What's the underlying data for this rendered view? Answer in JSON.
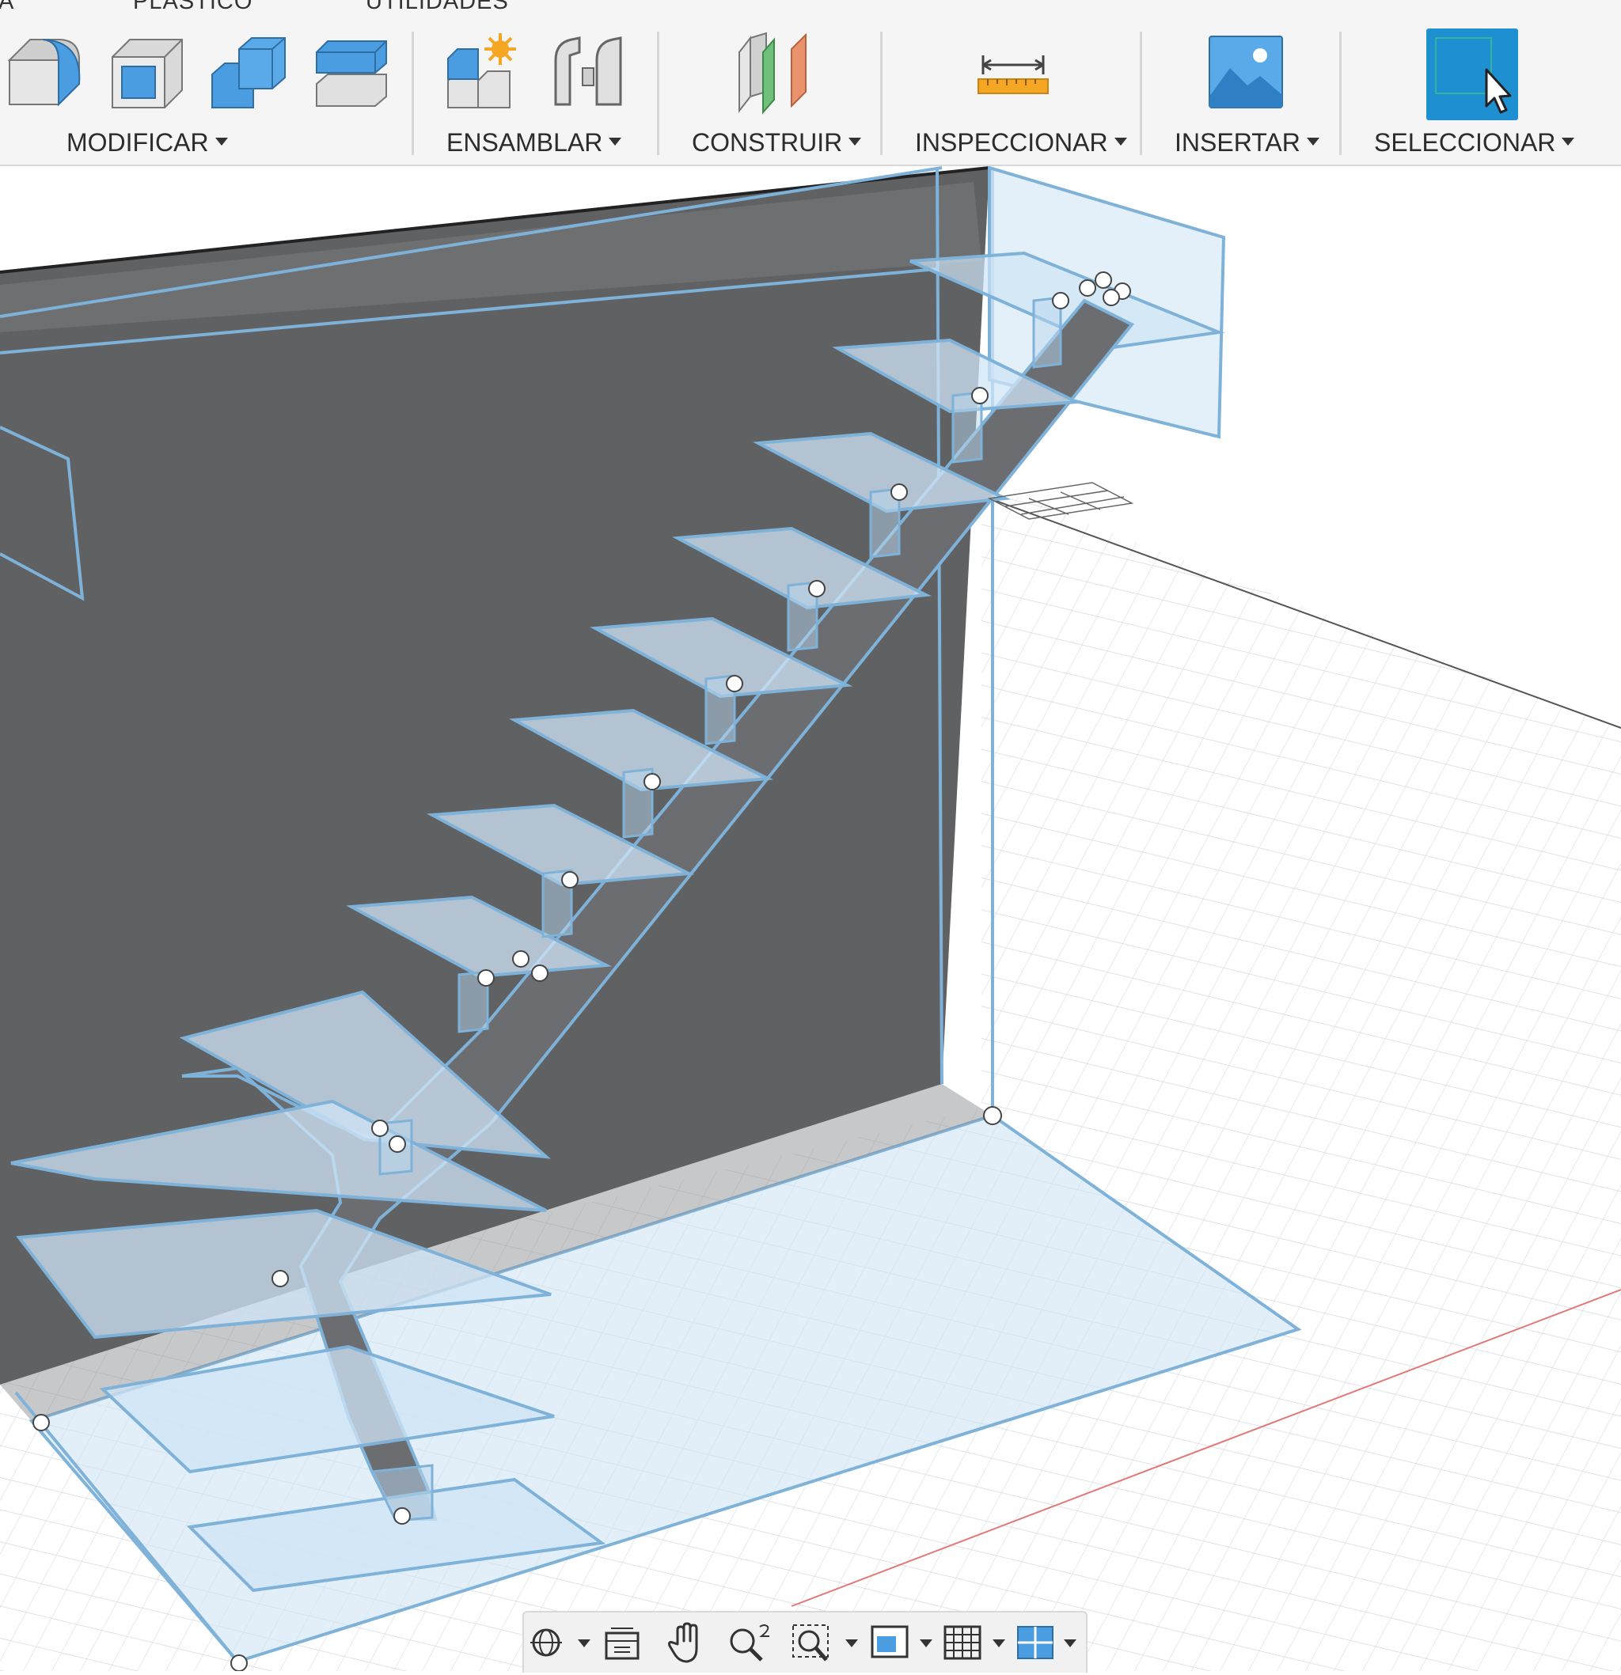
{
  "toolbar": {
    "tabs": [
      "A",
      "PLÁSTICO",
      "UTILIDADES"
    ],
    "groups": [
      {
        "label": "MODIFICAR",
        "tools": [
          "fillet-icon",
          "shell-icon",
          "combine-icon",
          "press-pull-icon"
        ]
      },
      {
        "label": "ENSAMBLAR",
        "tools": [
          "new-component-icon",
          "joint-icon"
        ]
      },
      {
        "label": "CONSTRUIR",
        "tools": [
          "offset-plane-icon"
        ]
      },
      {
        "label": "INSPECCIONAR",
        "tools": [
          "measure-icon"
        ]
      },
      {
        "label": "INSERTAR",
        "tools": [
          "insert-image-icon"
        ]
      },
      {
        "label": "SELECCIONAR",
        "tools": [
          "select-icon"
        ]
      }
    ],
    "selected_group": "SELECCIONAR",
    "accent_color": "#1e8fd0"
  },
  "viewport": {
    "model": "floating staircase with central stringer",
    "colors": {
      "wall": "#5f6163",
      "highlight": "#7fb2d8",
      "grid": "#d6dbe0",
      "x_axis": "#e07a7a"
    }
  },
  "navbar": {
    "tools": [
      "orbit-icon",
      "look-at-icon",
      "pan-icon",
      "zoom-icon",
      "fit-icon",
      "display-settings-icon",
      "grid-settings-icon",
      "viewports-icon"
    ]
  }
}
